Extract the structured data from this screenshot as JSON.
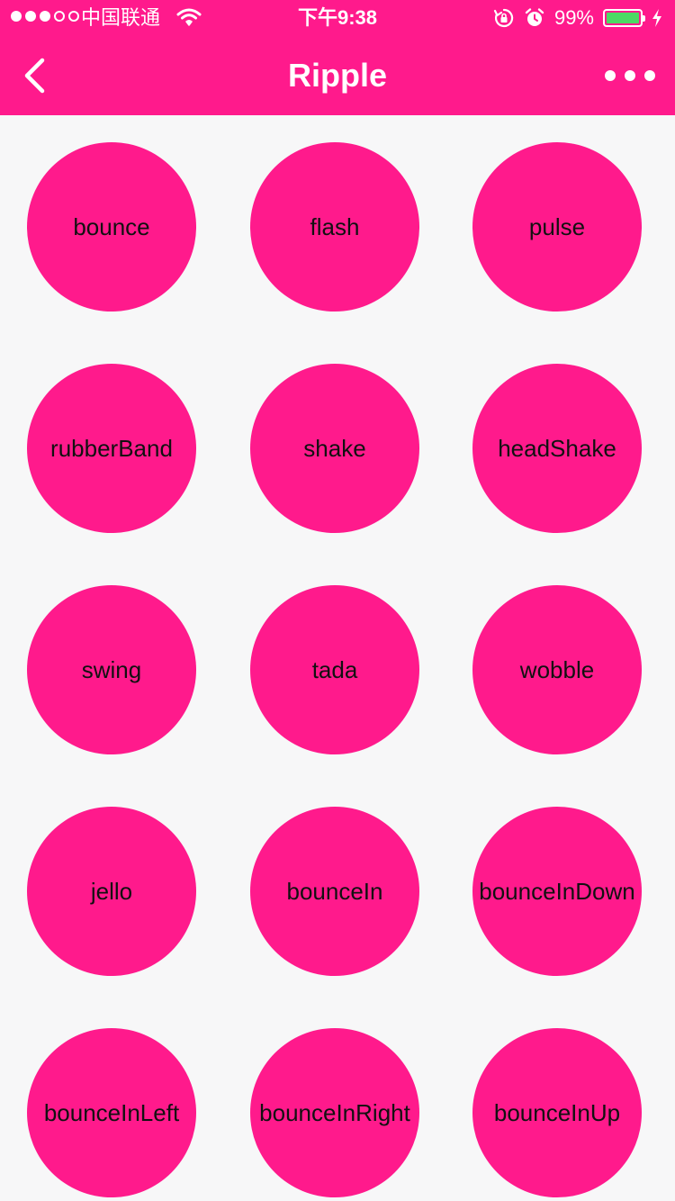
{
  "status_bar": {
    "carrier": "中国联通",
    "time": "下午9:38",
    "battery_percent": "99%",
    "battery_level": 0.99,
    "signal_strength": 3,
    "signal_max": 5
  },
  "nav": {
    "title": "Ripple",
    "back_icon": "chevron-left-icon",
    "more_icon": "ellipsis-icon"
  },
  "colors": {
    "accent": "#ff1a8c",
    "background": "#f7f7f8",
    "text_dark": "#111111",
    "battery_fill": "#4cd964"
  },
  "buttons": [
    {
      "label": "bounce"
    },
    {
      "label": "flash"
    },
    {
      "label": "pulse"
    },
    {
      "label": "rubberBand"
    },
    {
      "label": "shake"
    },
    {
      "label": "headShake"
    },
    {
      "label": "swing"
    },
    {
      "label": "tada"
    },
    {
      "label": "wobble"
    },
    {
      "label": "jello"
    },
    {
      "label": "bounceIn"
    },
    {
      "label": "bounceInDown"
    },
    {
      "label": "bounceInLeft"
    },
    {
      "label": "bounceInRight"
    },
    {
      "label": "bounceInUp"
    }
  ]
}
